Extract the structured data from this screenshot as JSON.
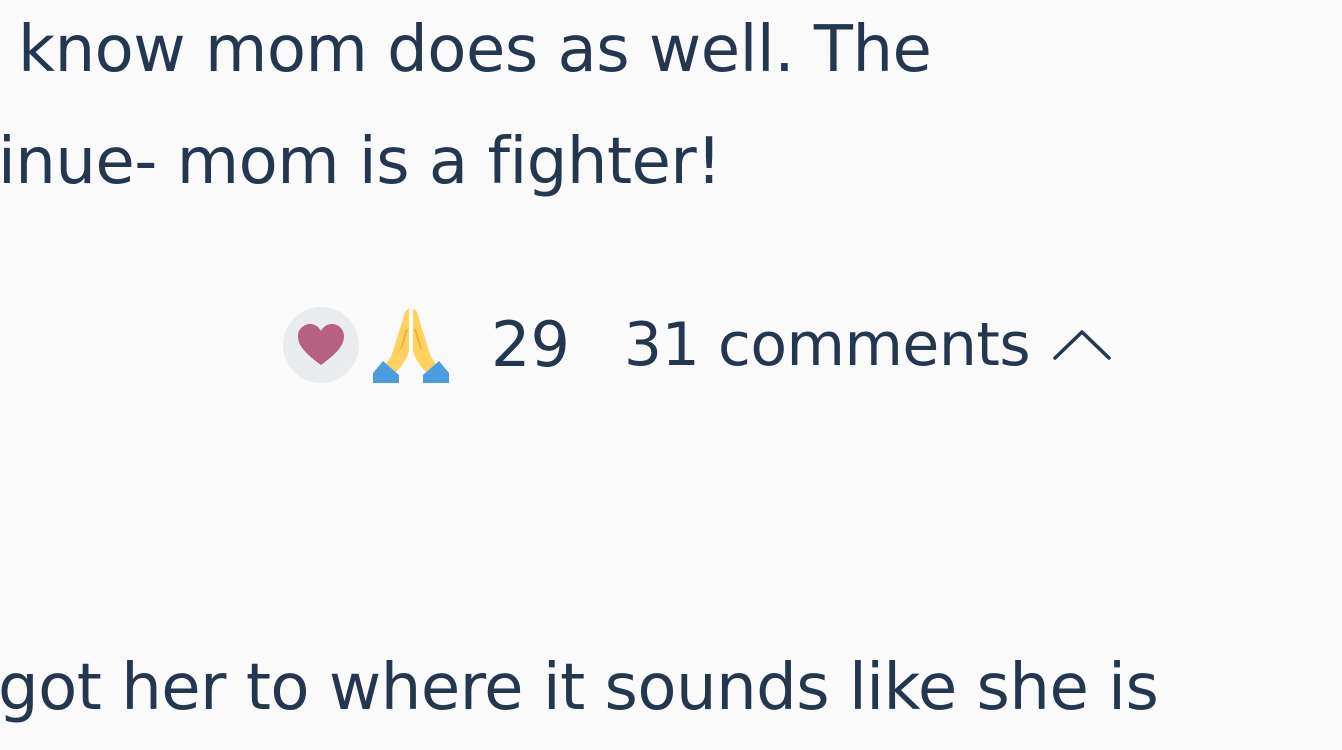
{
  "post": {
    "lines": [
      "know mom does as well. The",
      "inue- mom is a fighter!",
      "got her to where it sounds like she is"
    ]
  },
  "reactions": {
    "icons": [
      "heart-icon",
      "praying-hands-icon"
    ],
    "count": "29",
    "heart_color": "#b8607f",
    "heart_bg": "#e9edef"
  },
  "comments": {
    "label": "31 comments",
    "toggle_icon": "chevron-up-icon"
  },
  "colors": {
    "text": "#25364f",
    "background": "#fafafb"
  }
}
